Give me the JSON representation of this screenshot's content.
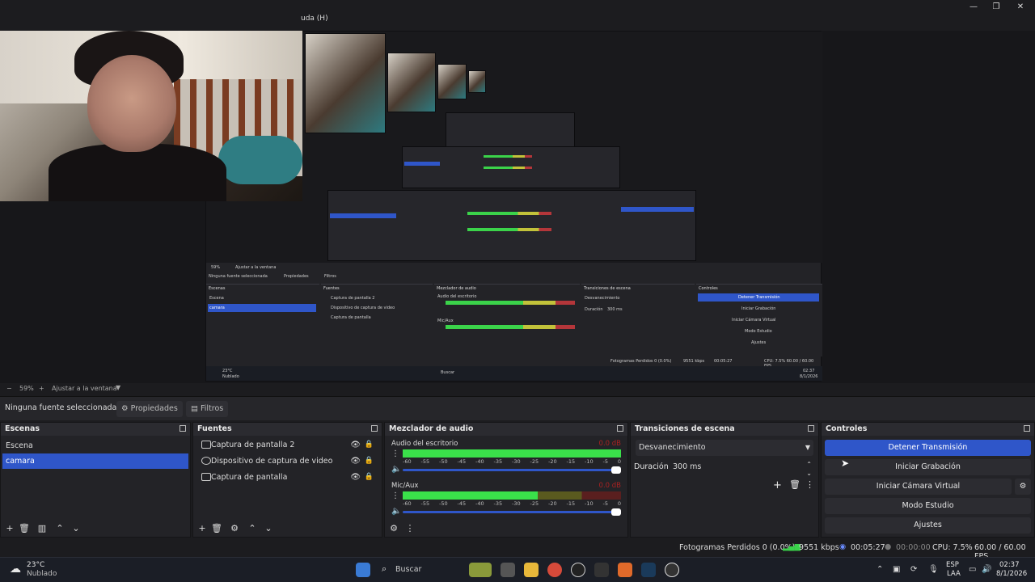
{
  "window": {
    "menu_visible": "uda (H)",
    "minimize": "—",
    "restore": "❐",
    "close": "✕"
  },
  "nested_preview": {
    "selection_text": "Ninguna fuente seleccionada",
    "properties": "Propiedades",
    "filters": "Filtros",
    "scenes_title": "Escenas",
    "sources_title": "Fuentes",
    "mixer_title": "Mezclador de audio",
    "transitions_title": "Transiciones de escena",
    "controls_title": "Controles",
    "scene_1": "Escena",
    "scene_2": "camara",
    "source_1": "Captura de pantalla 2",
    "source_2": "Dispositivo de captura de video",
    "source_3": "Captura de pantalla",
    "mixer_ch1": "Audio del escritorio",
    "mixer_ch2": "Mic/Aux",
    "fade": "Desvanecimiento",
    "duration": "Duración",
    "duration_val": "300 ms",
    "btn_stop": "Detener Transmisión",
    "btn_rec": "Iniciar Grabación",
    "btn_vcam": "Iniciar Cámara Virtual",
    "btn_studio": "Modo Estudio",
    "btn_settings": "Ajustes",
    "status": "Fotogramas Perdidos 0 (0.0%)",
    "status_fps": "CPU: 7.5%    60.00 / 60.00 FPS",
    "kbps": "9551 kbps",
    "time": "00:05:27",
    "zoom": "59%",
    "fit": "Ajustar a la ventana",
    "weather": "23°C",
    "weather_desc": "Nublado",
    "search": "Buscar",
    "clock_time": "02:37",
    "clock_date": "8/1/2026"
  },
  "zoombar": {
    "minus": "−",
    "zoom": "59%",
    "plus": "+",
    "fit": "Ajustar a la ventana"
  },
  "source_toolbar": {
    "selection": "Ninguna fuente seleccionada",
    "properties": "Propiedades",
    "filters": "Filtros"
  },
  "scenes": {
    "title": "Escenas",
    "items": [
      "Escena",
      "camara"
    ],
    "selected_index": 1
  },
  "sources": {
    "title": "Fuentes",
    "items": [
      "Captura de pantalla 2",
      "Dispositivo de captura de video",
      "Captura de pantalla"
    ]
  },
  "mixer": {
    "title": "Mezclador de audio",
    "channels": [
      {
        "name": "Audio del escritorio",
        "db": "0.0 dB",
        "level": 1.0
      },
      {
        "name": "Mic/Aux",
        "db": "0.0 dB",
        "level": 0.62
      }
    ],
    "ticks": [
      "-60",
      "-55",
      "-50",
      "-45",
      "-40",
      "-35",
      "-30",
      "-25",
      "-20",
      "-15",
      "-10",
      "-5",
      "0"
    ]
  },
  "transitions": {
    "title": "Transiciones de escena",
    "selected": "Desvanecimiento",
    "duration_label": "Duración",
    "duration_value": "300 ms"
  },
  "controls": {
    "title": "Controles",
    "stop_stream": "Detener Transmisión",
    "start_recording": "Iniciar Grabación",
    "start_virtual_cam": "Iniciar Cámara Virtual",
    "studio_mode": "Modo Estudio",
    "settings": "Ajustes"
  },
  "statusbar": {
    "dropped": "Fotogramas Perdidos 0 (0.0%)",
    "kbps": "9551 kbps",
    "stream_time": "00:05:27",
    "rec_time": "00:00:00",
    "cpu": "CPU: 7.5%",
    "fps": "60.00 / 60.00 FPS"
  },
  "taskbar": {
    "weather_temp": "23°C",
    "weather_desc": "Nublado",
    "search_placeholder": "Buscar",
    "lang": "ESP",
    "lang2": "LAA",
    "time": "02:37",
    "date": "8/1/2026"
  },
  "colors": {
    "accent": "#2f56c9",
    "panel": "#232327",
    "background": "#1c1c1f"
  }
}
